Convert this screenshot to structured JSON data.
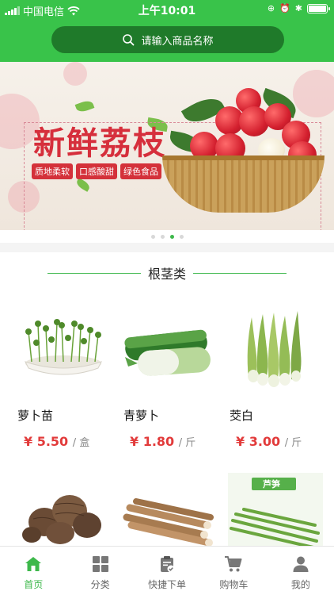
{
  "status_bar": {
    "carrier": "中国电信",
    "time": "上午10:01"
  },
  "search": {
    "placeholder": "请输入商品名称"
  },
  "banner": {
    "title": "新鲜荔枝",
    "tags": [
      "质地柔软",
      "口感酸甜",
      "绿色食品"
    ],
    "dots_total": 4,
    "dots_active": 3
  },
  "section": {
    "title": "根茎类"
  },
  "products": [
    {
      "name": "萝卜苗",
      "price": "¥ 5.50",
      "unit": "/ 盒",
      "image": "radish-sprouts-icon"
    },
    {
      "name": "青萝卜",
      "price": "¥ 1.80",
      "unit": "/ 斤",
      "image": "green-radish-icon"
    },
    {
      "name": "茭白",
      "price": "¥ 3.00",
      "unit": "/ 斤",
      "image": "water-bamboo-icon"
    },
    {
      "name": "",
      "price": "",
      "unit": "",
      "image": "taro-icon"
    },
    {
      "name": "",
      "price": "",
      "unit": "",
      "image": "yam-icon"
    },
    {
      "name": "",
      "price": "",
      "unit": "",
      "image": "asparagus-icon",
      "label": "芦笋"
    }
  ],
  "tabbar": {
    "items": [
      {
        "label": "首页",
        "icon": "home-icon",
        "active": true
      },
      {
        "label": "分类",
        "icon": "grid-icon",
        "active": false
      },
      {
        "label": "快捷下单",
        "icon": "clipboard-check-icon",
        "active": false
      },
      {
        "label": "购物车",
        "icon": "cart-icon",
        "active": false
      },
      {
        "label": "我的",
        "icon": "user-icon",
        "active": false
      }
    ]
  },
  "colors": {
    "brand_green": "#39c34a",
    "search_bg": "#1f7a2a",
    "price_red": "#e23b3b"
  }
}
